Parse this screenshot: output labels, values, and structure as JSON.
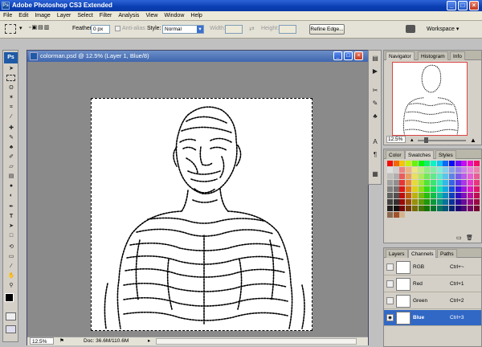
{
  "app": {
    "title": "Adobe Photoshop CS3 Extended",
    "logo": "Ps"
  },
  "menu": [
    "File",
    "Edit",
    "Image",
    "Layer",
    "Select",
    "Filter",
    "Analysis",
    "View",
    "Window",
    "Help"
  ],
  "options": {
    "feather_label": "Feather:",
    "feather_value": "0 px",
    "antialias_label": "Anti-alias",
    "style_label": "Style:",
    "style_value": "Normal",
    "width_label": "Width:",
    "height_label": "Height:",
    "refine_edge": "Refine Edge...",
    "workspace": "Workspace"
  },
  "document": {
    "title": "colorman.psd @ 12.5% (Layer 1, Blue/8)",
    "behind_title": "% (Layer 1, Blue/8)",
    "zoom": "12.5%",
    "doc_info": "Doc: 36.6M/110.6M"
  },
  "navigator": {
    "tabs": [
      "Navigator",
      "Histogram",
      "Info"
    ],
    "zoom": "12.5%"
  },
  "color_panel": {
    "tabs": [
      "Color",
      "Swatches",
      "Styles"
    ]
  },
  "layers_panel": {
    "tabs": [
      "Layers",
      "Channels",
      "Paths"
    ],
    "channels": [
      {
        "name": "RGB",
        "shortcut": "Ctrl+~",
        "selected": false
      },
      {
        "name": "Red",
        "shortcut": "Ctrl+1",
        "selected": false
      },
      {
        "name": "Green",
        "shortcut": "Ctrl+2",
        "selected": false
      },
      {
        "name": "Blue",
        "shortcut": "Ctrl+3",
        "selected": true
      }
    ]
  },
  "colors": {
    "title_blue": "#0a3fb3",
    "selection_blue": "#3168c6",
    "canvas_gray": "#8a8a8a"
  }
}
